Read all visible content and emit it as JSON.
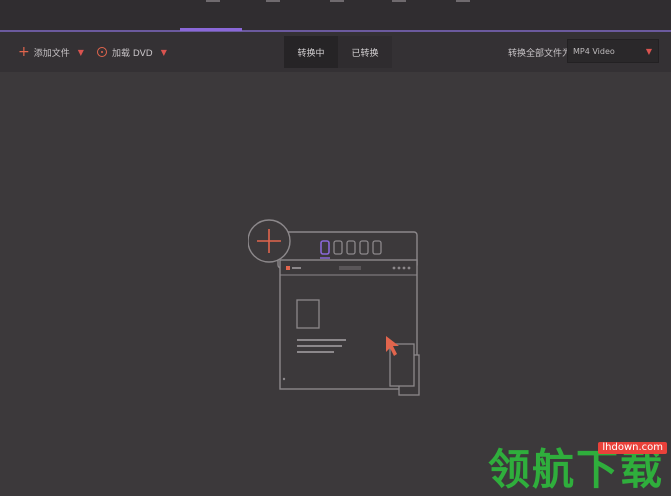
{
  "toolbar": {
    "add_files_label": "添加文件",
    "load_dvd_label": "加载 DVD",
    "tabs": [
      {
        "label": "转换中",
        "active": true
      },
      {
        "label": "已转换",
        "active": false
      }
    ],
    "convert_all_label": "转换全部文件为:",
    "output_format": "MP4 Video"
  },
  "colors": {
    "background": "#3c393b",
    "accent_purple": "#8a68d8",
    "accent_red": "#e2654d"
  },
  "icons": {
    "add": "plus-icon",
    "dvd": "disc-icon",
    "dropdown": "caret-down-icon",
    "cursor": "pointer-cursor-icon"
  },
  "watermark": {
    "text": "领航下载",
    "url": "lhdown.com"
  }
}
